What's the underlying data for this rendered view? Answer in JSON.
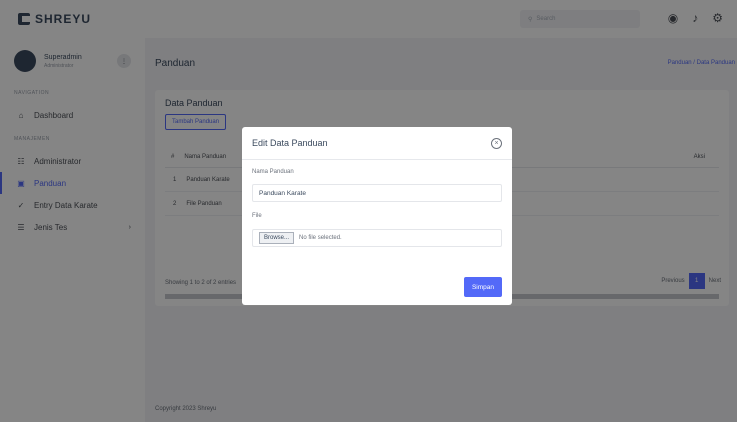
{
  "brand": {
    "name": "SHREYU"
  },
  "search": {
    "placeholder": "Search"
  },
  "top_icons": [
    "globe-icon",
    "bell-icon",
    "gear-icon"
  ],
  "user": {
    "name": "Superadmin",
    "role": "Administrator"
  },
  "sidebar": {
    "section_nav": "Navigation",
    "section_manage": "Manajemen",
    "items": [
      {
        "label": "Dashboard",
        "icon": "home-icon"
      },
      {
        "label": "Administrator",
        "icon": "users-icon"
      },
      {
        "label": "Panduan",
        "icon": "book-icon",
        "active": true
      },
      {
        "label": "Entry Data Karate",
        "icon": "edit-icon"
      },
      {
        "label": "Jenis Tes",
        "icon": "list-icon"
      }
    ]
  },
  "main": {
    "title": "Panduan",
    "breadcrumb": "Panduan / Data Panduan",
    "card_title": "Data Panduan",
    "add_button": "Tambah Panduan",
    "table": {
      "columns": [
        "#",
        "Nama Panduan",
        "Aksi"
      ],
      "rows": [
        {
          "no": "1",
          "name": "Panduan Karate"
        },
        {
          "no": "2",
          "name": "File Panduan"
        }
      ]
    },
    "info": "Showing 1 to 2 of 2 entries",
    "pager": {
      "prev": "Previous",
      "page": "1",
      "next": "Next"
    },
    "footer": "Copyright 2023 Shreyu"
  },
  "modal": {
    "title": "Edit Data Panduan",
    "name_label": "Nama Panduan",
    "name_value": "Panduan Karate",
    "file_label": "File",
    "browse_label": "Browse...",
    "no_file": "No file selected.",
    "save_label": "Simpan"
  },
  "colors": {
    "accent": "#5369f8",
    "overlay": "rgba(0,0,0,0.48)"
  }
}
